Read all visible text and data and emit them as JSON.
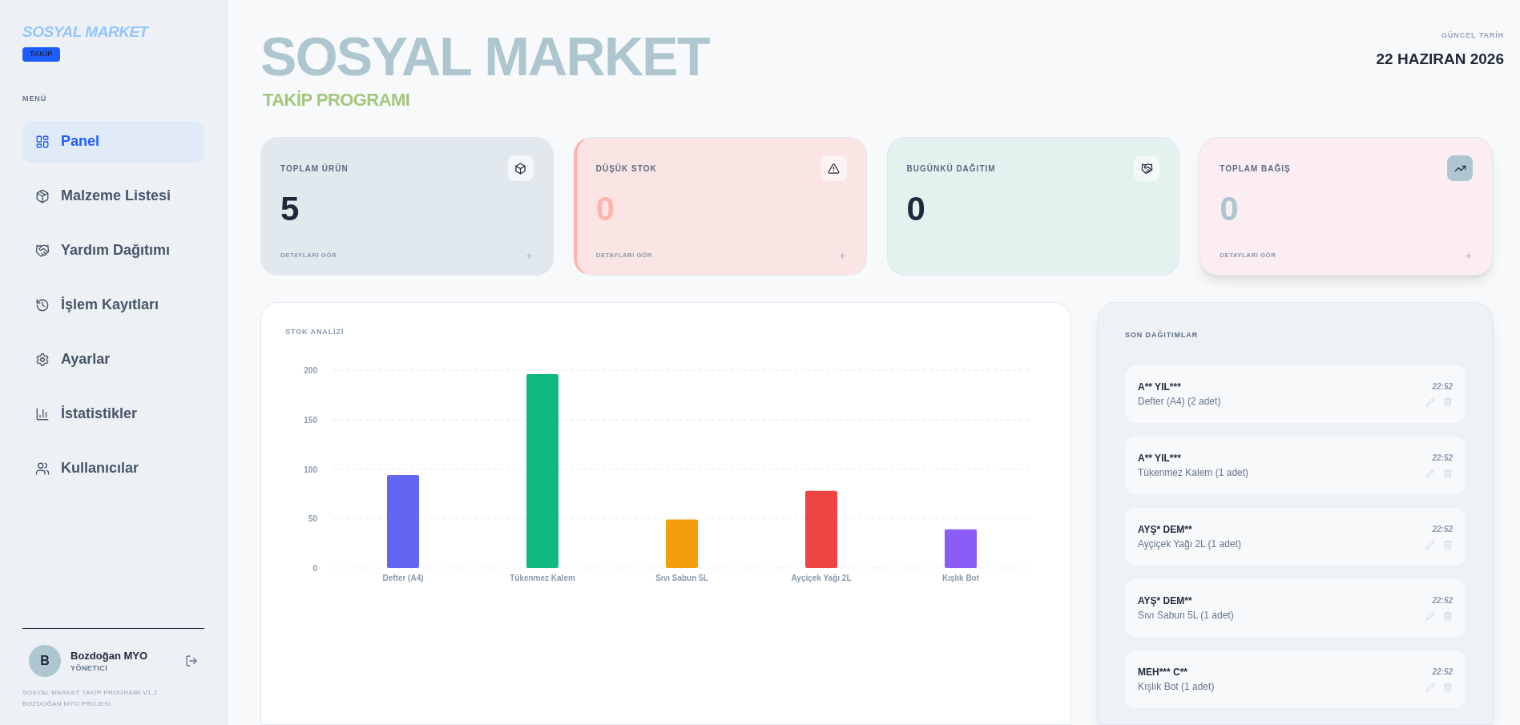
{
  "sidebar": {
    "logo": {
      "title": "SOSYAL MARKET",
      "badge": "TAKİP"
    },
    "menu_label": "MENÜ",
    "items": [
      {
        "label": "Panel",
        "selected": true
      },
      {
        "label": "Malzeme Listesi",
        "selected": false
      },
      {
        "label": "Yardım Dağıtımı",
        "selected": false
      },
      {
        "label": "İşlem Kayıtları",
        "selected": false
      },
      {
        "label": "Ayarlar",
        "selected": false
      },
      {
        "label": "İstatistikler",
        "selected": false
      },
      {
        "label": "Kullanıcılar",
        "selected": false
      }
    ],
    "user": {
      "initial": "B",
      "name": "Bozdoğan MYO",
      "role": "YÖNETICI"
    },
    "footer": [
      "SOSYAL MARKET TAKIP PROGRAMI V1.2",
      "BOZDOĞAN MYO PROJESI"
    ]
  },
  "header": {
    "title": "SOSYAL MARKET",
    "subtitle": "TAKİP PROGRAMI",
    "date_label": "GÜNCEL TARİH",
    "date": "22 HAZIRAN 2026"
  },
  "stats": [
    {
      "label": "TOPLAM ÜRÜN",
      "value": "5",
      "link": "DETAYLARI GÖR",
      "color": "#1e293b"
    },
    {
      "label": "DÜŞÜK STOK",
      "value": "0",
      "link": "DETAYLARI GÖR",
      "color": "#fdb5ad"
    },
    {
      "label": "BUGÜNKÜ DAĞITIM",
      "value": "0",
      "color": "#1e293b"
    },
    {
      "label": "TOPLAM BAĞIŞ",
      "value": "0",
      "link": "DETAYLARI GÖR",
      "color": "#aec6cf"
    }
  ],
  "chart": {
    "title": "STOK ANALİZİ",
    "chart_data": {
      "type": "bar",
      "categories": [
        "Defter (A4)",
        "Tükenmez Kalem",
        "Sıvı Sabun 5L",
        "Ayçiçek Yağı 2L",
        "Kışlık Bot"
      ],
      "values": [
        94,
        196,
        49,
        78,
        39
      ],
      "grid": true,
      "colors": [
        "#6366f1",
        "#10b981",
        "#f59e0b",
        "#ef4444",
        "#8b5cf6"
      ],
      "ylim": [
        0,
        200
      ],
      "yticks": [
        0,
        50,
        100,
        150,
        200
      ]
    }
  },
  "recent": {
    "title": "SON DAĞITIMLAR",
    "items": [
      {
        "name": "A** YIL***",
        "detail": "Defter (A4) (2 adet)",
        "time": "22:52"
      },
      {
        "name": "A** YIL***",
        "detail": "Tükenmez Kalem (1 adet)",
        "time": "22:52"
      },
      {
        "name": "AYŞ* DEM**",
        "detail": "Ayçiçek Yağı 2L (1 adet)",
        "time": "22:52"
      },
      {
        "name": "AYŞ* DEM**",
        "detail": "Sıvı Sabun 5L (1 adet)",
        "time": "22:52"
      },
      {
        "name": "MEH*** C**",
        "detail": "Kışlık Bot (1 adet)",
        "time": "22:52"
      }
    ]
  }
}
